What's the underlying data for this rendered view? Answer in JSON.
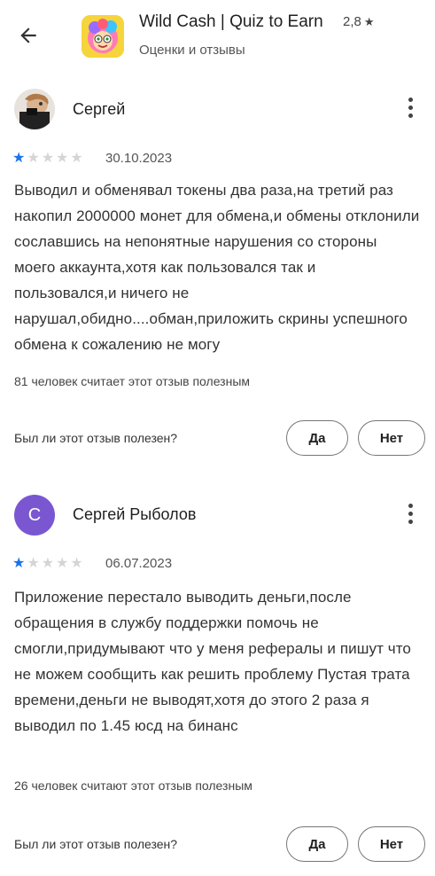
{
  "header": {
    "app_title": "Wild Cash | Quiz to Earn",
    "rating": "2,8",
    "subtitle": "Оценки и отзывы",
    "icons": {
      "back": "arrow-back-icon",
      "star": "star-icon",
      "app": "app-icon"
    }
  },
  "reviews": [
    {
      "author": "Сергей",
      "avatar_letter": "",
      "stars": 1,
      "max_stars": 5,
      "date": "30.10.2023",
      "text": "Выводил и обменявал токены два раза,на третий раз накопил 2000000 монет для обмена,и обмены отклонили сославшись на непонятные нарушения со стороны моего аккаунта,хотя как пользовался так и пользовался,и ничего не нарушал,обидно....обман,приложить скрины успешного обмена к сожалению не могу",
      "helpful": "81 человек считает этот отзыв полезным",
      "question": "Был ли этот отзыв полезен?",
      "yes": "Да",
      "no": "Нет"
    },
    {
      "author": "Сергей Рыболов",
      "avatar_letter": "С",
      "avatar_color": "#7a57d1",
      "stars": 1,
      "max_stars": 5,
      "date": "06.07.2023",
      "text": "Приложение перестало выводить деньги,после обращения в службу поддержки помочь не смогли,придумывают что у меня рефералы и пишут что не можем сообщить как решить проблему Пустая трата времени,деньги не выводят,хотя до этого 2 раза я выводил по 1.45 юсд на бинанс",
      "helpful": "26 человек считают этот отзыв полезным",
      "question": "Был ли этот отзыв полезен?",
      "yes": "Да",
      "no": "Нет"
    }
  ],
  "colors": {
    "star_on": "#1a73e8",
    "star_off": "#d5d5d5",
    "avatar": "#7a57d1"
  }
}
